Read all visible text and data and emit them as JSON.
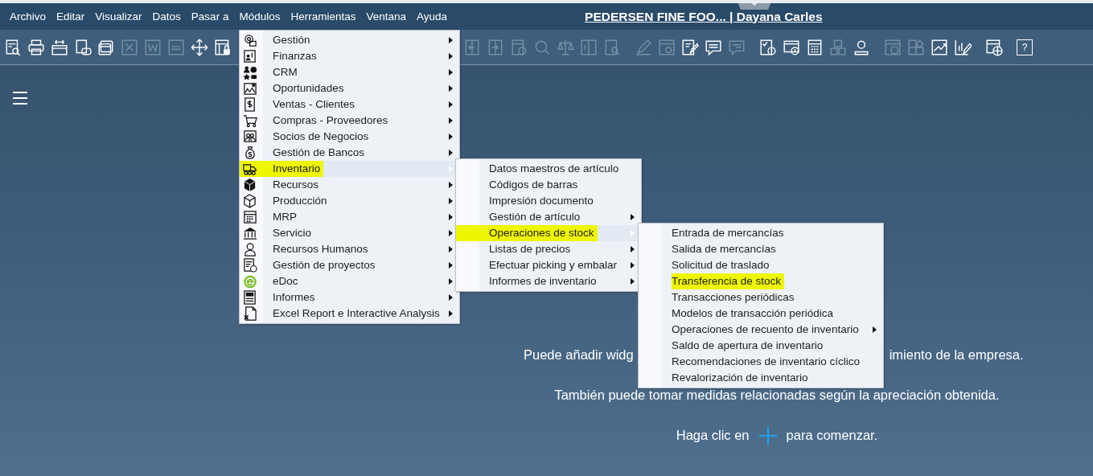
{
  "menu_bar": {
    "items": [
      {
        "label": "Archivo"
      },
      {
        "label": "Editar"
      },
      {
        "label": "Visualizar"
      },
      {
        "label": "Datos"
      },
      {
        "label": "Pasar a"
      },
      {
        "label": "Módulos"
      },
      {
        "label": "Herramientas"
      },
      {
        "label": "Ventana"
      },
      {
        "label": "Ayuda"
      }
    ],
    "title": "PEDERSEN FINE FOO... | Dayana Carles"
  },
  "toolbar": {
    "buttons_left": [
      {
        "disabled": false
      },
      {
        "disabled": false
      },
      {
        "disabled": false
      },
      {
        "disabled": false
      },
      {
        "disabled": false
      },
      {
        "disabled": true
      },
      {
        "disabled": true
      },
      {
        "disabled": true
      },
      {
        "disabled": false
      },
      {
        "disabled": false
      }
    ],
    "button_groups_right": [
      [
        {
          "disabled": true
        },
        {
          "disabled": true
        },
        {
          "disabled": true
        },
        {
          "disabled": true
        },
        {
          "disabled": true
        },
        {
          "disabled": true
        },
        {
          "disabled": true
        }
      ],
      [
        {
          "disabled": true
        },
        {
          "disabled": true
        },
        {
          "disabled": false
        },
        {
          "disabled": false
        },
        {
          "disabled": true
        }
      ],
      [
        {
          "disabled": false
        },
        {
          "disabled": false
        },
        {
          "disabled": false
        },
        {
          "disabled": true
        },
        {
          "disabled": false
        }
      ],
      [
        {
          "disabled": true
        },
        {
          "disabled": true
        },
        {
          "disabled": false
        },
        {
          "disabled": false
        }
      ],
      [
        {
          "disabled": false
        }
      ]
    ],
    "help_button": {
      "label": "?"
    }
  },
  "modules_menu": {
    "items": [
      {
        "label": "Gestión",
        "selected": false,
        "highlighted": false,
        "has_submenu": true
      },
      {
        "label": "Finanzas",
        "selected": false,
        "highlighted": false,
        "has_submenu": true
      },
      {
        "label": "CRM",
        "selected": false,
        "highlighted": false,
        "has_submenu": true
      },
      {
        "label": "Oportunidades",
        "selected": false,
        "highlighted": false,
        "has_submenu": true
      },
      {
        "label": "Ventas - Clientes",
        "selected": false,
        "highlighted": false,
        "has_submenu": true
      },
      {
        "label": "Compras - Proveedores",
        "selected": false,
        "highlighted": false,
        "has_submenu": true
      },
      {
        "label": "Socios de Negocios",
        "selected": false,
        "highlighted": false,
        "has_submenu": true
      },
      {
        "label": "Gestión de Bancos",
        "selected": false,
        "highlighted": false,
        "has_submenu": true
      },
      {
        "label": "Inventario",
        "selected": true,
        "highlighted": true,
        "has_submenu": true
      },
      {
        "label": "Recursos",
        "selected": false,
        "highlighted": false,
        "has_submenu": true
      },
      {
        "label": "Producción",
        "selected": false,
        "highlighted": false,
        "has_submenu": true
      },
      {
        "label": "MRP",
        "selected": false,
        "highlighted": false,
        "has_submenu": true
      },
      {
        "label": "Servicio",
        "selected": false,
        "highlighted": false,
        "has_submenu": true
      },
      {
        "label": "Recursos Humanos",
        "selected": false,
        "highlighted": false,
        "has_submenu": true
      },
      {
        "label": "Gestión de proyectos",
        "selected": false,
        "highlighted": false,
        "has_submenu": true
      },
      {
        "label": "eDoc",
        "selected": false,
        "highlighted": false,
        "has_submenu": true
      },
      {
        "label": "Informes",
        "selected": false,
        "highlighted": false,
        "has_submenu": true
      },
      {
        "label": "Excel Report e Interactive Analysis",
        "selected": false,
        "highlighted": false,
        "has_submenu": true
      }
    ]
  },
  "inventory_menu": {
    "items": [
      {
        "label": "Datos maestros de artículo",
        "selected": false,
        "highlighted": false,
        "has_submenu": false
      },
      {
        "label": "Códigos de barras",
        "selected": false,
        "highlighted": false,
        "has_submenu": false
      },
      {
        "label": "Impresión documento",
        "selected": false,
        "highlighted": false,
        "has_submenu": false
      },
      {
        "label": "Gestión de artículo",
        "selected": false,
        "highlighted": false,
        "has_submenu": true
      },
      {
        "label": "Operaciones de stock",
        "selected": true,
        "highlighted": true,
        "has_submenu": true
      },
      {
        "label": "Listas de precios",
        "selected": false,
        "highlighted": false,
        "has_submenu": true
      },
      {
        "label": "Efectuar picking y embalar",
        "selected": false,
        "highlighted": false,
        "has_submenu": true
      },
      {
        "label": "Informes de inventario",
        "selected": false,
        "highlighted": false,
        "has_submenu": true
      }
    ]
  },
  "stock_operations_menu": {
    "items": [
      {
        "label": "Entrada de mercancías",
        "selected": false,
        "highlighted": false,
        "has_submenu": false
      },
      {
        "label": "Salida de mercancías",
        "selected": false,
        "highlighted": false,
        "has_submenu": false
      },
      {
        "label": "Solicitud de traslado",
        "selected": false,
        "highlighted": false,
        "has_submenu": false
      },
      {
        "label": "Transferencia de stock",
        "selected": false,
        "highlighted": true,
        "has_submenu": false
      },
      {
        "label": "Transacciones periódicas",
        "selected": false,
        "highlighted": false,
        "has_submenu": false
      },
      {
        "label": "Modelos de transacción periódica",
        "selected": false,
        "highlighted": false,
        "has_submenu": false
      },
      {
        "label": "Operaciones de recuento de inventario",
        "selected": false,
        "highlighted": false,
        "has_submenu": true
      },
      {
        "label": "Saldo de apertura de inventario",
        "selected": false,
        "highlighted": false,
        "has_submenu": false
      },
      {
        "label": "Recomendaciones de inventario cíclico",
        "selected": false,
        "highlighted": false,
        "has_submenu": false
      },
      {
        "label": "Revalorización de inventario",
        "selected": false,
        "highlighted": false,
        "has_submenu": false
      }
    ]
  },
  "dashboard": {
    "line_1_left": "Puede añadir widg",
    "line_1_right": "imiento de la empresa.",
    "line_2": "También puede tomar medidas relacionadas según la apreciación obtenida.",
    "line_3_before": "Haga clic en",
    "line_3_after": "para comenzar."
  }
}
